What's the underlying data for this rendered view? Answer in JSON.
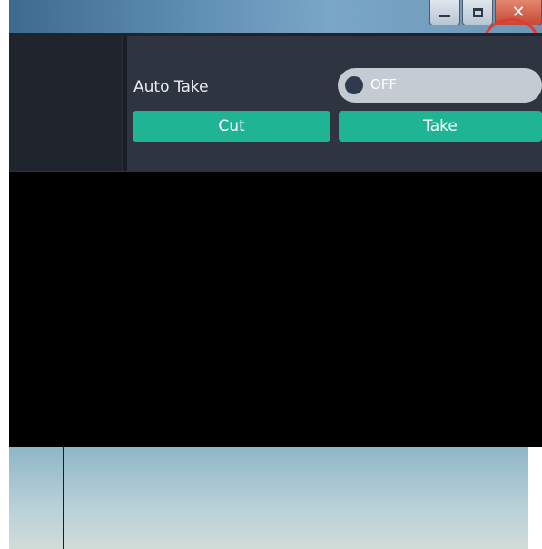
{
  "window": {
    "controls": [
      {
        "name": "minimize",
        "icon": "minimize-icon"
      },
      {
        "name": "restore",
        "icon": "restore-icon"
      },
      {
        "name": "close",
        "icon": "close-icon"
      }
    ],
    "highlight_color": "#e03a35"
  },
  "take_panel": {
    "auto_take_label": "Auto Take",
    "auto_take_toggle": {
      "state": "OFF"
    },
    "cut_label": "Cut",
    "take_label": "Take"
  },
  "colors": {
    "panel_bg": "#2f3540",
    "action_button": "#1fb594",
    "toggle_track": "#c5cbd2",
    "preview_bg": "#000000"
  }
}
